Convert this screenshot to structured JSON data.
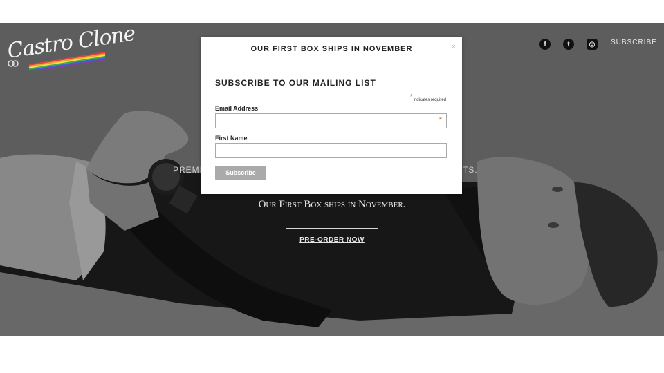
{
  "header": {
    "logo_text": "Castro Clone",
    "social": {
      "facebook_icon": "facebook-icon",
      "twitter_icon": "twitter-icon",
      "instagram_icon": "instagram-icon"
    },
    "subscribe_label": "SUBSCRIBE"
  },
  "hero": {
    "tagline_left": "PREMIU",
    "tagline_right": "DUCTS.",
    "subtitle": "Our First Box ships in November.",
    "preorder_label": "PRE-ORDER NOW"
  },
  "modal": {
    "title": "OUR FIRST BOX SHIPS IN NOVEMBER",
    "close_label": "×",
    "form_title": "SUBSCRIBE TO OUR MAILING LIST",
    "required_star": "*",
    "required_note": "indicates required",
    "email_label": "Email Address",
    "email_value": "",
    "first_name_label": "First Name",
    "first_name_value": "",
    "submit_label": "Subscribe"
  },
  "colors": {
    "accent_star": "#c0622a",
    "button_gray": "#aaaaaa"
  }
}
